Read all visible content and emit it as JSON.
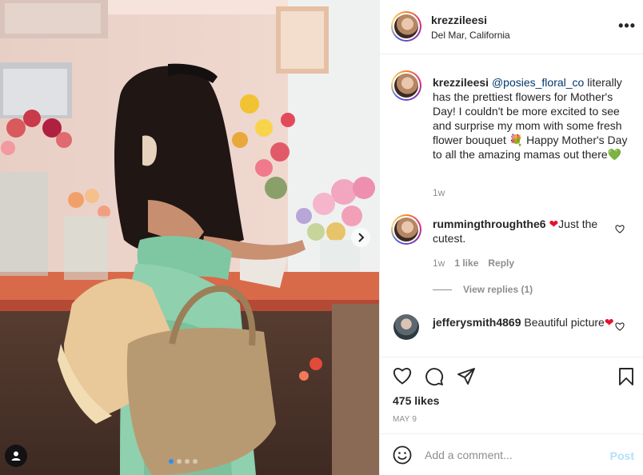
{
  "post": {
    "username": "krezzileesi",
    "location": "Del Mar, California",
    "more_icon": "more-horizontal-icon"
  },
  "caption": {
    "username": "krezzileesi",
    "mention": "@posies_floral_co",
    "text_1": "literally has the prettiest flowers for Mother's Day! I couldn't be more excited to see and surprise my mom with some fresh flower bouquet",
    "emoji_bouquet": "💐",
    "text_2": "Happy Mother's Day to all the amazing mamas out there",
    "emoji_heart": "💚",
    "time": "1w"
  },
  "comments": [
    {
      "username": "rummingthroughthe6",
      "emoji": "❤",
      "text": "Just the cutest.",
      "time": "1w",
      "likes": "1 like",
      "reply": "Reply",
      "view_replies": "View replies (1)"
    },
    {
      "username": "jefferysmith4869",
      "text": "Beautiful picture",
      "emoji": "❤"
    }
  ],
  "actions": {
    "likes": "475 likes",
    "date": "MAY 9"
  },
  "add_comment": {
    "placeholder": "Add a comment...",
    "post_label": "Post"
  },
  "colors": {
    "link": "#00376b",
    "muted": "#8e8e8e",
    "post_disabled": "#b2dffc",
    "carousel_dot_active": "#2c8ff0"
  }
}
